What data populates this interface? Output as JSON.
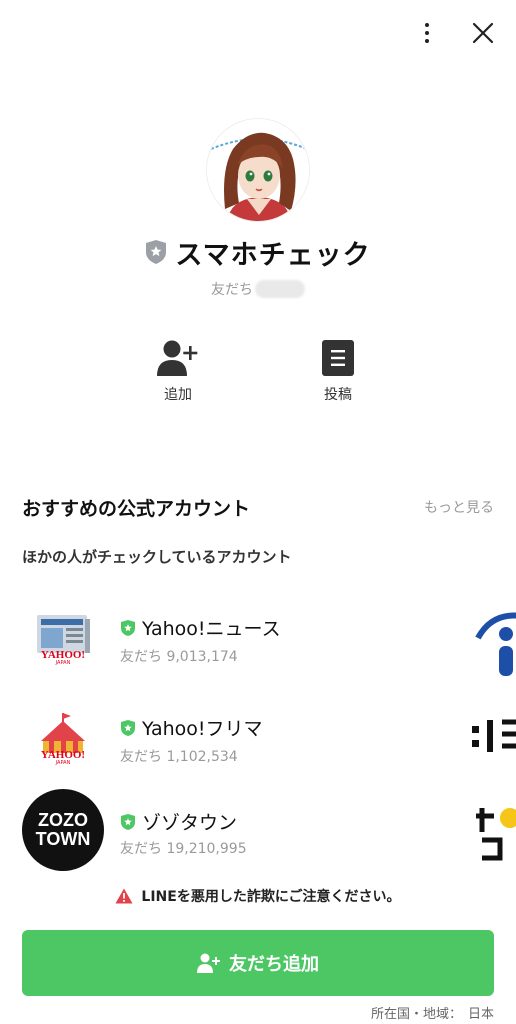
{
  "header": {
    "menu_icon": "more-vertical-icon",
    "close_icon": "close-icon"
  },
  "profile": {
    "name": "スマホチェック",
    "badge_icon": "shield-badge-icon",
    "friends_label": "友だち",
    "avatar_icon": "anime-girl-avatar"
  },
  "actions": [
    {
      "label": "追加",
      "icon": "add-friend-icon"
    },
    {
      "label": "投稿",
      "icon": "posts-icon"
    }
  ],
  "recommend": {
    "title": "おすすめの公式アカウント",
    "more": "もっと見る",
    "subtitle": "ほかの人がチェックしているアカウント",
    "accounts": [
      {
        "name": "Yahoo!ニュース",
        "friends": "友だち 9,013,174",
        "logo_text": "YAHOO!",
        "logo_sub": "JAPAN"
      },
      {
        "name": "Yahoo!フリマ",
        "friends": "友だち 1,102,534",
        "logo_text": "YAHOO!",
        "logo_sub": "JAPAN"
      },
      {
        "name": "ゾゾタウン",
        "friends": "友だち 19,210,995",
        "logo_text_1": "ZOZO",
        "logo_text_2": "TOWN"
      }
    ]
  },
  "warning": {
    "text": "LINEを悪用した詐欺にご注意ください。",
    "icon": "warning-triangle-icon"
  },
  "add_button": {
    "label": "友だち追加",
    "icon": "add-friend-icon"
  },
  "region": {
    "label": "所在国・地域：",
    "value": "日本"
  },
  "colors": {
    "accent": "#4cc764",
    "badge_green": "#4cc764",
    "warning_red": "#e2434b"
  }
}
